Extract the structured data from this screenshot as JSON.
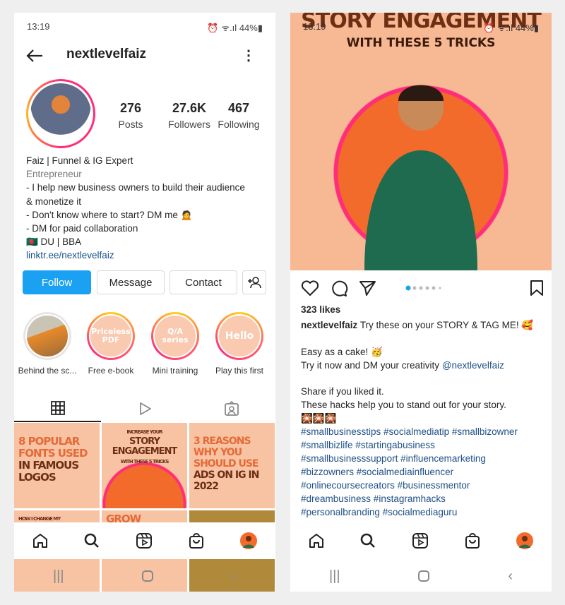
{
  "status": {
    "time": "13:19",
    "battery": "44%"
  },
  "profile": {
    "username": "nextlevelfaiz",
    "stats": [
      {
        "value": "276",
        "label": "Posts"
      },
      {
        "value": "27.6K",
        "label": "Followers"
      },
      {
        "value": "467",
        "label": "Following"
      }
    ],
    "bio": {
      "name": "Faiz | Funnel & IG Expert",
      "category": "Entrepreneur",
      "lines": [
        "- I help new business owners to build their audience",
        "& monetize it",
        "- Don't know where to start? DM me 🙍",
        "- DM for paid collaboration",
        "🇧🇩 DU | BBA"
      ],
      "link": "linktr.ee/nextlevelfaiz"
    },
    "buttons": {
      "follow": "Follow",
      "message": "Message",
      "contact": "Contact"
    },
    "highlights": [
      {
        "label": "Behind the sc...",
        "cover": ""
      },
      {
        "label": "Free e-book",
        "cover": "Priceless PDF"
      },
      {
        "label": "Mini training",
        "cover": "Q/A series"
      },
      {
        "label": "Play this first",
        "cover": "Hello"
      }
    ],
    "grid": [
      {
        "light": "8 POPULAR FONTS USED",
        "dark": "IN FAMOUS LOGOS"
      },
      {
        "top": "INCREASE YOUR",
        "dark": "STORY ENGAGEMENT",
        "sub": "WITH THESE 5 TRICKS"
      },
      {
        "light": "3 REASONS WHY YOU SHOULD USE",
        "dark": "ADS ON IG IN 2022"
      },
      {
        "top": "HOW I CHANGE MY"
      },
      {
        "light": "GROW"
      },
      {
        "light": ""
      }
    ]
  },
  "post": {
    "image_title": "STORY ENGAGEMENT",
    "image_subtitle": "WITH THESE 5 TRICKS",
    "likes": "323 likes",
    "author": "nextlevelfaiz",
    "caption_first": "Try these on your STORY & TAG ME! 🥰",
    "lines": [
      "Easy as a cake! 🥳"
    ],
    "dm_line": "Try it now and DM your creativity",
    "mention": "@nextlevelfaiz",
    "lines2": [
      "Share if you liked it.",
      "These hacks help you to stand out for your story.",
      "🎇🎇🎇"
    ],
    "hashtags": [
      "#smallbusinesstips #socialmediatip #smallbizowner",
      "#smallbizlife #startingabusiness",
      "#smallbusinesssupport #influencemarketing",
      "#bizzowners #socialmediainfluencer",
      "#onlinecoursecreators #businessmentor",
      "#dreambusiness #instagramhacks",
      "#personalbranding #socialmediaguru"
    ],
    "carousel": {
      "count": 6,
      "active": 1
    }
  },
  "colors": {
    "follow": "#1aa1f2",
    "link": "#1f4f86",
    "orange": "#f26b2a",
    "ring": "#ff2d7a"
  }
}
